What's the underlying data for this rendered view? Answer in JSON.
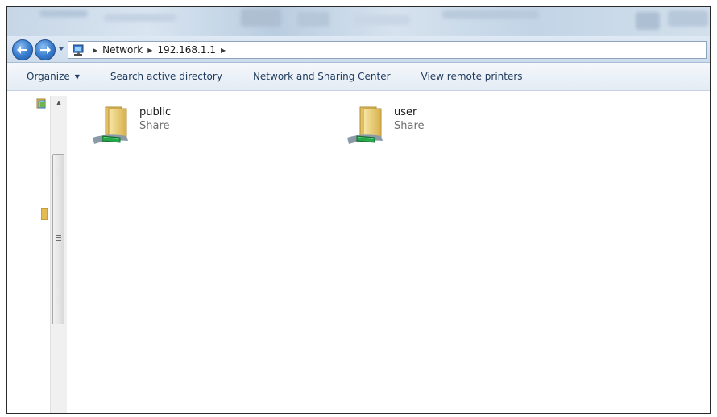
{
  "breadcrumb": {
    "items": [
      "Network",
      "192.168.1.1"
    ]
  },
  "toolbar": {
    "organize": "Organize",
    "search_ad": "Search active directory",
    "network_center": "Network and Sharing Center",
    "remote_printers": "View remote printers"
  },
  "shares": [
    {
      "name": "public",
      "type": "Share"
    },
    {
      "name": "user",
      "type": "Share"
    }
  ],
  "icons": {
    "back": "back-arrow-icon",
    "forward": "forward-arrow-icon",
    "share": "network-share-folder-icon"
  },
  "colors": {
    "nav_button": "#3a7fd0",
    "command_text": "#1e395b",
    "subtext": "#6d6d6d"
  }
}
